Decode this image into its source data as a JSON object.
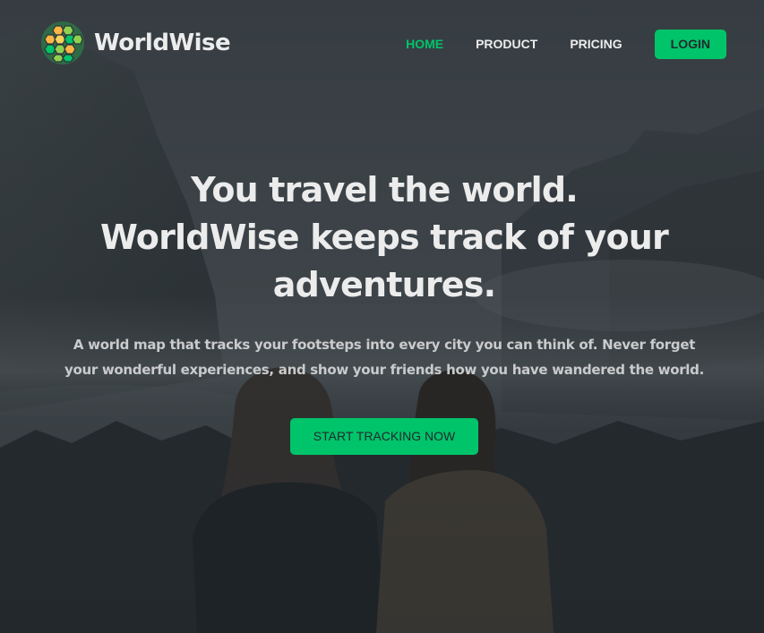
{
  "brand": {
    "name": "WorldWise",
    "logo_icon": "hexagon-globe-icon"
  },
  "nav": {
    "items": [
      {
        "label": "HOME",
        "active": true
      },
      {
        "label": "PRODUCT",
        "active": false
      },
      {
        "label": "PRICING",
        "active": false
      }
    ],
    "login_label": "LOGIN"
  },
  "hero": {
    "headline_line1": "You travel the world.",
    "headline_line2": "WorldWise keeps track of your adventures.",
    "tagline": "A world map that tracks your footsteps into every city you can think of. Never forget your wonderful experiences, and show your friends how you have wandered the world.",
    "cta_label": "START TRACKING NOW"
  },
  "colors": {
    "accent": "#00c46a",
    "text_light": "#ececec",
    "overlay": "#2d3439",
    "logo_yellow": "#ffb545",
    "logo_green": "#00c46a"
  }
}
